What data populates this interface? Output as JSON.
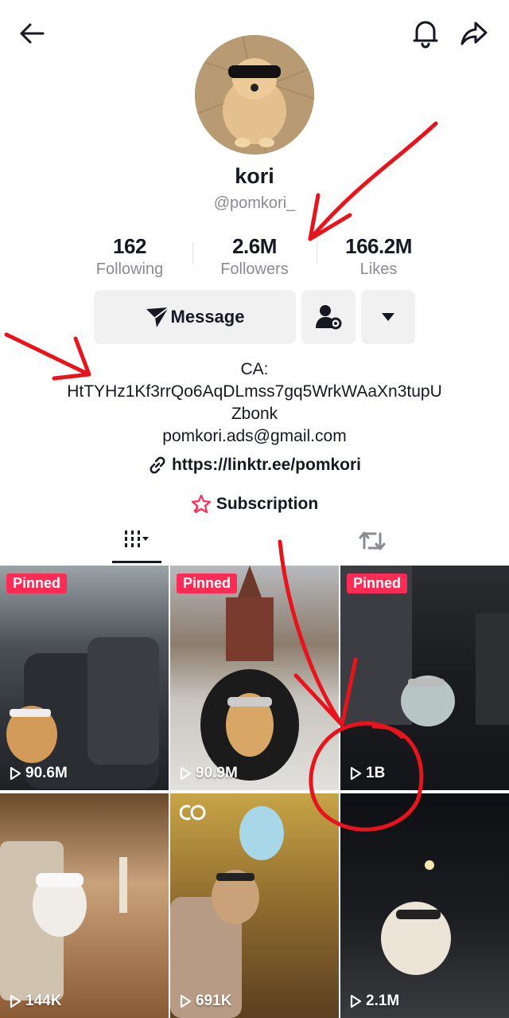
{
  "profile": {
    "name": "kori",
    "handle": "@pomkori_"
  },
  "stats": [
    {
      "value": "162",
      "label": "Following"
    },
    {
      "value": "2.6M",
      "label": "Followers"
    },
    {
      "value": "166.2M",
      "label": "Likes"
    }
  ],
  "actions": {
    "message_label": "Message"
  },
  "bio": {
    "line1": "CA:",
    "line2": "HtTYHz1Kf3rrQo6AqDLmss7gq5WrkWAaXn3tupU",
    "line3": "Zbonk",
    "email": "pomkori.ads@gmail.com",
    "link": "https://linktr.ee/pomkori",
    "subscription": "Subscription"
  },
  "videos": [
    {
      "pinned": "Pinned",
      "views": "90.6M"
    },
    {
      "pinned": "Pinned",
      "views": "90.9M"
    },
    {
      "pinned": "Pinned",
      "views": "1B"
    },
    {
      "pinned": "",
      "views": "144K"
    },
    {
      "pinned": "",
      "views": "691K"
    },
    {
      "pinned": "",
      "views": "2.1M"
    }
  ],
  "colors": {
    "accent": "#fe2c55",
    "text": "#161823",
    "muted": "#8a8b91",
    "button_bg": "#f1f1f2",
    "annotation": "#e8141d"
  },
  "icons": [
    "back-arrow-icon",
    "bell-icon",
    "share-icon",
    "send-icon",
    "add-friend-icon",
    "chevron-down-icon",
    "link-icon",
    "subscription-icon",
    "grid-icon",
    "repost-icon",
    "play-icon",
    "collab-icon"
  ]
}
